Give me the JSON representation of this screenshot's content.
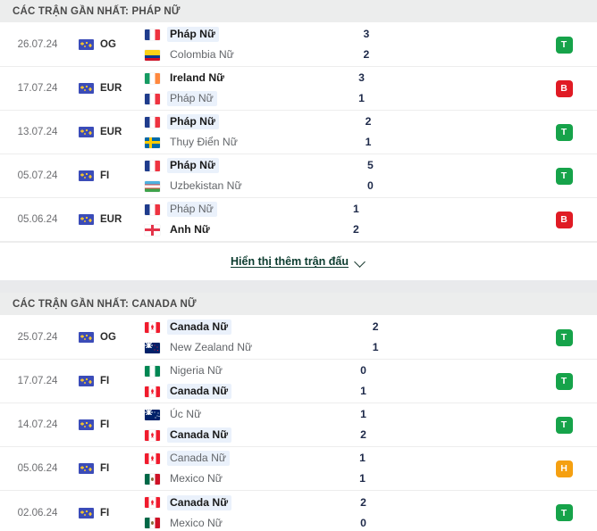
{
  "sections": [
    {
      "title": "CÁC TRẬN GẦN NHẤT: PHÁP NỮ",
      "matches": [
        {
          "date": "26.07.24",
          "competition": "OG",
          "home": {
            "name": "Pháp Nữ",
            "flag": "fr",
            "bold": true,
            "highlight": true
          },
          "away": {
            "name": "Colombia Nữ",
            "flag": "co",
            "bold": false,
            "highlight": false
          },
          "home_score": "3",
          "away_score": "2",
          "result": "T",
          "result_color": "#16a34a"
        },
        {
          "date": "17.07.24",
          "competition": "EUR",
          "home": {
            "name": "Ireland Nữ",
            "flag": "ie",
            "bold": true,
            "highlight": false
          },
          "away": {
            "name": "Pháp Nữ",
            "flag": "fr",
            "bold": false,
            "highlight": true
          },
          "home_score": "3",
          "away_score": "1",
          "result": "B",
          "result_color": "#e01b24"
        },
        {
          "date": "13.07.24",
          "competition": "EUR",
          "home": {
            "name": "Pháp Nữ",
            "flag": "fr",
            "bold": true,
            "highlight": true
          },
          "away": {
            "name": "Thụy Điển Nữ",
            "flag": "se",
            "bold": false,
            "highlight": false
          },
          "home_score": "2",
          "away_score": "1",
          "result": "T",
          "result_color": "#16a34a"
        },
        {
          "date": "05.07.24",
          "competition": "FI",
          "home": {
            "name": "Pháp Nữ",
            "flag": "fr",
            "bold": true,
            "highlight": true
          },
          "away": {
            "name": "Uzbekistan Nữ",
            "flag": "uz",
            "bold": false,
            "highlight": false
          },
          "home_score": "5",
          "away_score": "0",
          "result": "T",
          "result_color": "#16a34a"
        },
        {
          "date": "05.06.24",
          "competition": "EUR",
          "home": {
            "name": "Pháp Nữ",
            "flag": "fr",
            "bold": false,
            "highlight": true
          },
          "away": {
            "name": "Anh Nữ",
            "flag": "en",
            "bold": true,
            "highlight": false
          },
          "home_score": "1",
          "away_score": "2",
          "result": "B",
          "result_color": "#e01b24"
        }
      ],
      "show_more_label": "Hiển thị thêm trận đấu",
      "has_show_more": true
    },
    {
      "title": "CÁC TRẬN GẦN NHẤT: CANADA NỮ",
      "matches": [
        {
          "date": "25.07.24",
          "competition": "OG",
          "home": {
            "name": "Canada Nữ",
            "flag": "ca",
            "bold": true,
            "highlight": true
          },
          "away": {
            "name": "New Zealand Nữ",
            "flag": "nz",
            "bold": false,
            "highlight": false
          },
          "home_score": "2",
          "away_score": "1",
          "result": "T",
          "result_color": "#16a34a"
        },
        {
          "date": "17.07.24",
          "competition": "FI",
          "home": {
            "name": "Nigeria Nữ",
            "flag": "ng",
            "bold": false,
            "highlight": false
          },
          "away": {
            "name": "Canada Nữ",
            "flag": "ca",
            "bold": true,
            "highlight": true
          },
          "home_score": "0",
          "away_score": "1",
          "result": "T",
          "result_color": "#16a34a"
        },
        {
          "date": "14.07.24",
          "competition": "FI",
          "home": {
            "name": "Úc Nữ",
            "flag": "au",
            "bold": false,
            "highlight": false
          },
          "away": {
            "name": "Canada Nữ",
            "flag": "ca",
            "bold": true,
            "highlight": true
          },
          "home_score": "1",
          "away_score": "2",
          "result": "T",
          "result_color": "#16a34a"
        },
        {
          "date": "05.06.24",
          "competition": "FI",
          "home": {
            "name": "Canada Nữ",
            "flag": "ca",
            "bold": false,
            "highlight": true
          },
          "away": {
            "name": "Mexico Nữ",
            "flag": "mx",
            "bold": false,
            "highlight": false
          },
          "home_score": "1",
          "away_score": "1",
          "result": "H",
          "result_color": "#f5a011"
        },
        {
          "date": "02.06.24",
          "competition": "FI",
          "home": {
            "name": "Canada Nữ",
            "flag": "ca",
            "bold": true,
            "highlight": true
          },
          "away": {
            "name": "Mexico Nữ",
            "flag": "mx",
            "bold": false,
            "highlight": false
          },
          "home_score": "2",
          "away_score": "0",
          "result": "T",
          "result_color": "#16a34a"
        }
      ],
      "has_show_more": false
    }
  ]
}
